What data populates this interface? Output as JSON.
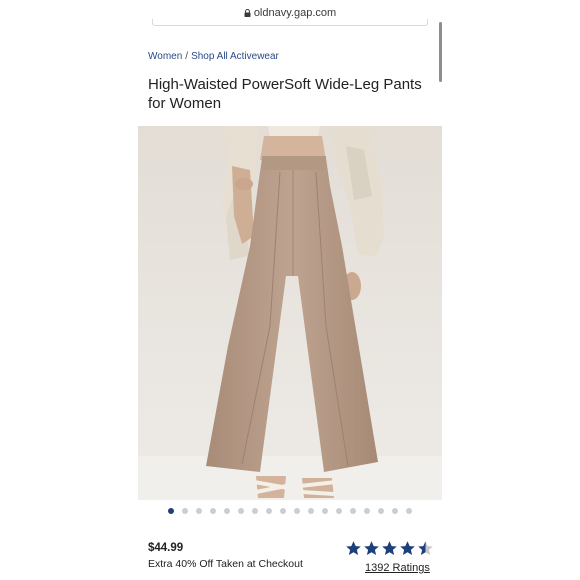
{
  "browser": {
    "url": "oldnavy.gap.com"
  },
  "breadcrumb": {
    "items": [
      "Women",
      "Shop All Activewear"
    ],
    "separator": "/"
  },
  "product": {
    "title": "High-Waisted PowerSoft Wide-Leg Pants for Women",
    "price": "$44.99",
    "promo": "Extra 40% Off Taken at Checkout",
    "rating": 4.5,
    "rating_max": 5,
    "ratings_label": "1392 Ratings"
  },
  "gallery": {
    "image_count": 18,
    "active_index": 0
  },
  "colors": {
    "brand_blue": "#1d3f7a",
    "pants": "#b89d89"
  }
}
